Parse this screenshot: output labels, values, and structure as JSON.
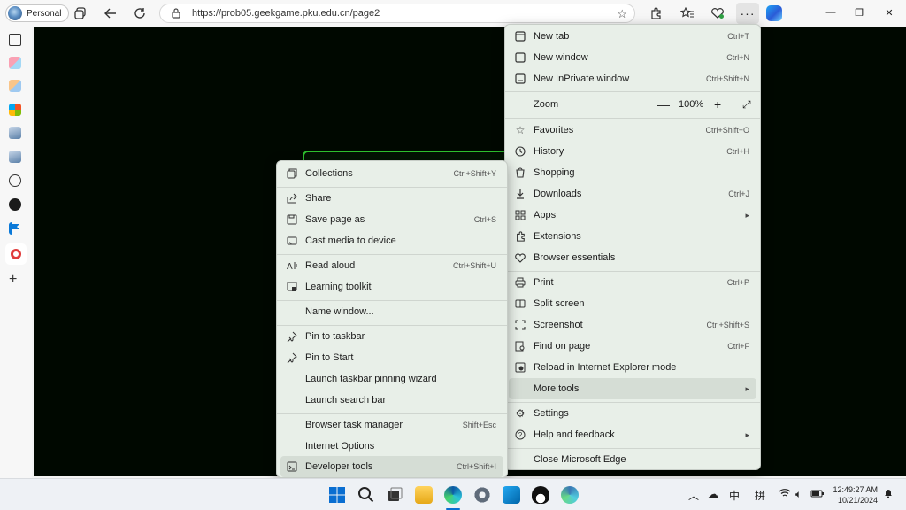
{
  "browser": {
    "profile_label": "Personal",
    "url": "https://prob05.geekgame.pku.edu.cn/page2"
  },
  "main_menu": {
    "items": [
      {
        "label": "New tab",
        "shortcut": "Ctrl+T",
        "icon": "new-tab-icon"
      },
      {
        "label": "New window",
        "shortcut": "Ctrl+N",
        "icon": "new-window-icon"
      },
      {
        "label": "New InPrivate window",
        "shortcut": "Ctrl+Shift+N",
        "icon": "inprivate-icon"
      },
      {
        "label": "Zoom",
        "value": "100%"
      },
      {
        "label": "Favorites",
        "shortcut": "Ctrl+Shift+O",
        "icon": "favorites-icon"
      },
      {
        "label": "History",
        "shortcut": "Ctrl+H",
        "icon": "history-icon"
      },
      {
        "label": "Shopping",
        "shortcut": "",
        "icon": "shopping-icon"
      },
      {
        "label": "Downloads",
        "shortcut": "Ctrl+J",
        "icon": "downloads-icon"
      },
      {
        "label": "Apps",
        "shortcut": "",
        "icon": "apps-icon"
      },
      {
        "label": "Extensions",
        "shortcut": "",
        "icon": "extensions-icon"
      },
      {
        "label": "Browser essentials",
        "shortcut": "",
        "icon": "heart-pulse-icon"
      },
      {
        "label": "Print",
        "shortcut": "Ctrl+P",
        "icon": "print-icon"
      },
      {
        "label": "Split screen",
        "shortcut": "",
        "icon": "split-screen-icon"
      },
      {
        "label": "Screenshot",
        "shortcut": "Ctrl+Shift+S",
        "icon": "screenshot-icon"
      },
      {
        "label": "Find on page",
        "shortcut": "Ctrl+F",
        "icon": "find-icon"
      },
      {
        "label": "Reload in Internet Explorer mode",
        "shortcut": "",
        "icon": "ie-mode-icon"
      },
      {
        "label": "More tools",
        "shortcut": "",
        "icon": ""
      },
      {
        "label": "Settings",
        "shortcut": "",
        "icon": "gear-icon"
      },
      {
        "label": "Help and feedback",
        "shortcut": "",
        "icon": "help-icon"
      },
      {
        "label": "Close Microsoft Edge",
        "shortcut": "",
        "icon": ""
      }
    ]
  },
  "more_tools_menu": {
    "items": [
      {
        "label": "Collections",
        "shortcut": "Ctrl+Shift+Y",
        "icon": "collections-icon"
      },
      {
        "label": "Share",
        "shortcut": "",
        "icon": "share-icon"
      },
      {
        "label": "Save page as",
        "shortcut": "Ctrl+S",
        "icon": "save-icon"
      },
      {
        "label": "Cast media to device",
        "shortcut": "",
        "icon": "cast-icon"
      },
      {
        "label": "Read aloud",
        "shortcut": "Ctrl+Shift+U",
        "icon": "read-aloud-icon"
      },
      {
        "label": "Learning toolkit",
        "shortcut": "",
        "icon": "learning-toolkit-icon"
      },
      {
        "label": "Name window...",
        "shortcut": "",
        "icon": ""
      },
      {
        "label": "Pin to taskbar",
        "shortcut": "",
        "icon": "pin-icon"
      },
      {
        "label": "Pin to Start",
        "shortcut": "",
        "icon": "pin-icon"
      },
      {
        "label": "Launch taskbar pinning wizard",
        "shortcut": "",
        "icon": ""
      },
      {
        "label": "Launch search bar",
        "shortcut": "",
        "icon": ""
      },
      {
        "label": "Browser task manager",
        "shortcut": "Shift+Esc",
        "icon": ""
      },
      {
        "label": "Internet Options",
        "shortcut": "",
        "icon": ""
      },
      {
        "label": "Developer tools",
        "shortcut": "Ctrl+Shift+I",
        "icon": "developer-tools-icon"
      }
    ]
  },
  "tray": {
    "ime_1": "中",
    "ime_2": "拼",
    "time": "12:49:27 AM",
    "date": "10/21/2024"
  }
}
